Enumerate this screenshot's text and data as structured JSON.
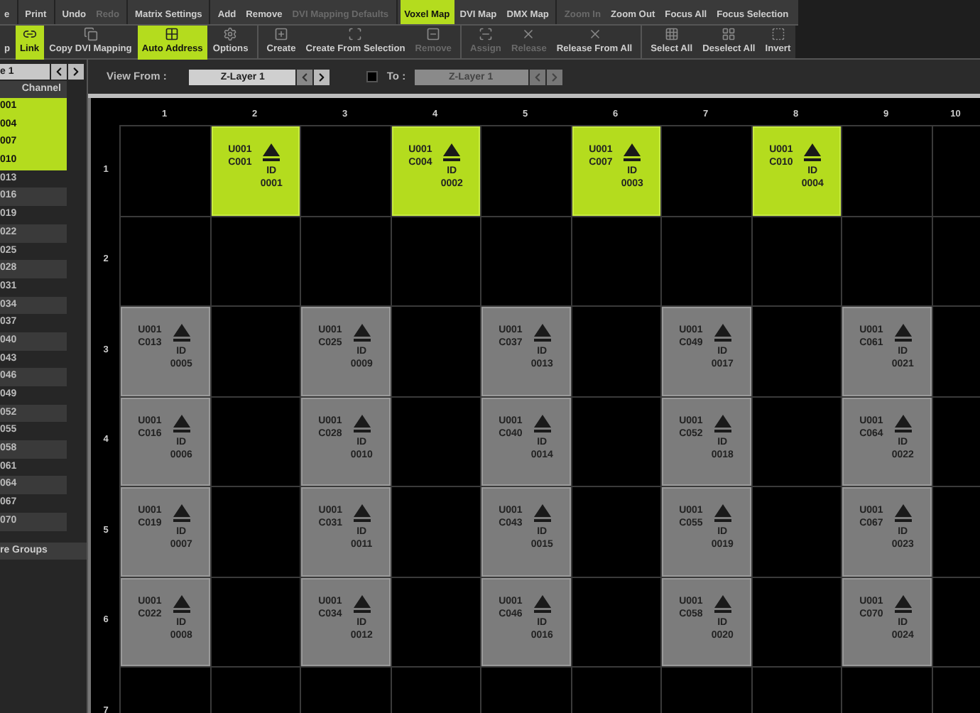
{
  "toolbar_top": [
    [
      {
        "label": "e",
        "selected": false,
        "disabled": false
      }
    ],
    [
      {
        "label": "Print",
        "selected": false,
        "disabled": false
      }
    ],
    [
      {
        "label": "Undo",
        "selected": false,
        "disabled": false
      },
      {
        "label": "Redo",
        "selected": false,
        "disabled": true
      }
    ],
    [
      {
        "label": "Matrix Settings",
        "selected": false,
        "disabled": false
      }
    ],
    [
      {
        "label": "Add",
        "selected": false,
        "disabled": false
      },
      {
        "label": "Remove",
        "selected": false,
        "disabled": false
      },
      {
        "label": "DVI Mapping Defaults",
        "selected": false,
        "disabled": true
      }
    ],
    [
      {
        "label": "Voxel Map",
        "selected": true,
        "disabled": false
      },
      {
        "label": "DVI Map",
        "selected": false,
        "disabled": false
      },
      {
        "label": "DMX Map",
        "selected": false,
        "disabled": false
      }
    ],
    [
      {
        "label": "Zoom In",
        "selected": false,
        "disabled": true
      },
      {
        "label": "Zoom Out",
        "selected": false,
        "disabled": false
      },
      {
        "label": "Focus All",
        "selected": false,
        "disabled": false
      },
      {
        "label": "Focus Selection",
        "selected": false,
        "disabled": false
      }
    ]
  ],
  "toolbar_bottom": [
    [
      {
        "label": "p",
        "selected": false,
        "disabled": false
      },
      {
        "label": "Link",
        "selected": true,
        "disabled": false
      },
      {
        "label": "Copy DVI Mapping",
        "selected": false,
        "disabled": false
      },
      {
        "label": "Auto Address",
        "selected": true,
        "disabled": false
      },
      {
        "label": "Options",
        "selected": false,
        "disabled": false
      }
    ],
    [
      {
        "label": "Create",
        "selected": false,
        "disabled": false
      },
      {
        "label": "Create From Selection",
        "selected": false,
        "disabled": false
      },
      {
        "label": "Remove",
        "selected": false,
        "disabled": true
      }
    ],
    [
      {
        "label": "Assign",
        "selected": false,
        "disabled": true
      },
      {
        "label": "Release",
        "selected": false,
        "disabled": true
      },
      {
        "label": "Release From All",
        "selected": false,
        "disabled": false
      }
    ],
    [
      {
        "label": "Select All",
        "selected": false,
        "disabled": false
      },
      {
        "label": "Deselect All",
        "selected": false,
        "disabled": false
      },
      {
        "label": "Invert",
        "selected": false,
        "disabled": false
      }
    ]
  ],
  "sidebar": {
    "layer": "e 1",
    "column_header": "Channel",
    "items": [
      {
        "label": "001",
        "selected": true
      },
      {
        "label": "004",
        "selected": true
      },
      {
        "label": "007",
        "selected": true
      },
      {
        "label": "010",
        "selected": true
      },
      {
        "label": "013",
        "selected": false
      },
      {
        "label": "016",
        "selected": false
      },
      {
        "label": "019",
        "selected": false
      },
      {
        "label": "022",
        "selected": false
      },
      {
        "label": "025",
        "selected": false
      },
      {
        "label": "028",
        "selected": false
      },
      {
        "label": "031",
        "selected": false
      },
      {
        "label": "034",
        "selected": false
      },
      {
        "label": "037",
        "selected": false
      },
      {
        "label": "040",
        "selected": false
      },
      {
        "label": "043",
        "selected": false
      },
      {
        "label": "046",
        "selected": false
      },
      {
        "label": "049",
        "selected": false
      },
      {
        "label": "052",
        "selected": false
      },
      {
        "label": "055",
        "selected": false
      },
      {
        "label": "058",
        "selected": false
      },
      {
        "label": "061",
        "selected": false
      },
      {
        "label": "064",
        "selected": false
      },
      {
        "label": "067",
        "selected": false
      },
      {
        "label": "070",
        "selected": false
      }
    ],
    "groups_header": "re Groups"
  },
  "view_bar": {
    "from_label": "View From :",
    "from_value": "Z-Layer 1",
    "to_checked": false,
    "to_label": "To :",
    "to_value": "Z-Layer 1"
  },
  "grid": {
    "columns": [
      "1",
      "2",
      "3",
      "4",
      "5",
      "6",
      "7",
      "8",
      "9",
      "10"
    ],
    "rows": [
      {
        "label": "1",
        "cells": [
          {
            "kind": "empty"
          },
          {
            "kind": "fixture",
            "selected": true,
            "universe": "U001",
            "channel": "C001",
            "id_label": "ID",
            "id": "0001"
          },
          {
            "kind": "empty"
          },
          {
            "kind": "fixture",
            "selected": true,
            "universe": "U001",
            "channel": "C004",
            "id_label": "ID",
            "id": "0002"
          },
          {
            "kind": "empty"
          },
          {
            "kind": "fixture",
            "selected": true,
            "universe": "U001",
            "channel": "C007",
            "id_label": "ID",
            "id": "0003"
          },
          {
            "kind": "empty"
          },
          {
            "kind": "fixture",
            "selected": true,
            "universe": "U001",
            "channel": "C010",
            "id_label": "ID",
            "id": "0004"
          },
          {
            "kind": "empty"
          },
          {
            "kind": "empty"
          }
        ]
      },
      {
        "label": "2",
        "cells": [
          {
            "kind": "empty"
          },
          {
            "kind": "empty"
          },
          {
            "kind": "empty"
          },
          {
            "kind": "empty"
          },
          {
            "kind": "empty"
          },
          {
            "kind": "empty"
          },
          {
            "kind": "empty"
          },
          {
            "kind": "empty"
          },
          {
            "kind": "empty"
          },
          {
            "kind": "empty"
          }
        ]
      },
      {
        "label": "3",
        "cells": [
          {
            "kind": "fixture",
            "selected": false,
            "universe": "U001",
            "channel": "C013",
            "id_label": "ID",
            "id": "0005"
          },
          {
            "kind": "empty"
          },
          {
            "kind": "fixture",
            "selected": false,
            "universe": "U001",
            "channel": "C025",
            "id_label": "ID",
            "id": "0009"
          },
          {
            "kind": "empty"
          },
          {
            "kind": "fixture",
            "selected": false,
            "universe": "U001",
            "channel": "C037",
            "id_label": "ID",
            "id": "0013"
          },
          {
            "kind": "empty"
          },
          {
            "kind": "fixture",
            "selected": false,
            "universe": "U001",
            "channel": "C049",
            "id_label": "ID",
            "id": "0017"
          },
          {
            "kind": "empty"
          },
          {
            "kind": "fixture",
            "selected": false,
            "universe": "U001",
            "channel": "C061",
            "id_label": "ID",
            "id": "0021"
          },
          {
            "kind": "empty"
          }
        ]
      },
      {
        "label": "4",
        "cells": [
          {
            "kind": "fixture",
            "selected": false,
            "universe": "U001",
            "channel": "C016",
            "id_label": "ID",
            "id": "0006"
          },
          {
            "kind": "empty"
          },
          {
            "kind": "fixture",
            "selected": false,
            "universe": "U001",
            "channel": "C028",
            "id_label": "ID",
            "id": "0010"
          },
          {
            "kind": "empty"
          },
          {
            "kind": "fixture",
            "selected": false,
            "universe": "U001",
            "channel": "C040",
            "id_label": "ID",
            "id": "0014"
          },
          {
            "kind": "empty"
          },
          {
            "kind": "fixture",
            "selected": false,
            "universe": "U001",
            "channel": "C052",
            "id_label": "ID",
            "id": "0018"
          },
          {
            "kind": "empty"
          },
          {
            "kind": "fixture",
            "selected": false,
            "universe": "U001",
            "channel": "C064",
            "id_label": "ID",
            "id": "0022"
          },
          {
            "kind": "empty"
          }
        ]
      },
      {
        "label": "5",
        "cells": [
          {
            "kind": "fixture",
            "selected": false,
            "universe": "U001",
            "channel": "C019",
            "id_label": "ID",
            "id": "0007"
          },
          {
            "kind": "empty"
          },
          {
            "kind": "fixture",
            "selected": false,
            "universe": "U001",
            "channel": "C031",
            "id_label": "ID",
            "id": "0011"
          },
          {
            "kind": "empty"
          },
          {
            "kind": "fixture",
            "selected": false,
            "universe": "U001",
            "channel": "C043",
            "id_label": "ID",
            "id": "0015"
          },
          {
            "kind": "empty"
          },
          {
            "kind": "fixture",
            "selected": false,
            "universe": "U001",
            "channel": "C055",
            "id_label": "ID",
            "id": "0019"
          },
          {
            "kind": "empty"
          },
          {
            "kind": "fixture",
            "selected": false,
            "universe": "U001",
            "channel": "C067",
            "id_label": "ID",
            "id": "0023"
          },
          {
            "kind": "empty"
          }
        ]
      },
      {
        "label": "6",
        "cells": [
          {
            "kind": "fixture",
            "selected": false,
            "universe": "U001",
            "channel": "C022",
            "id_label": "ID",
            "id": "0008"
          },
          {
            "kind": "empty"
          },
          {
            "kind": "fixture",
            "selected": false,
            "universe": "U001",
            "channel": "C034",
            "id_label": "ID",
            "id": "0012"
          },
          {
            "kind": "empty"
          },
          {
            "kind": "fixture",
            "selected": false,
            "universe": "U001",
            "channel": "C046",
            "id_label": "ID",
            "id": "0016"
          },
          {
            "kind": "empty"
          },
          {
            "kind": "fixture",
            "selected": false,
            "universe": "U001",
            "channel": "C058",
            "id_label": "ID",
            "id": "0020"
          },
          {
            "kind": "empty"
          },
          {
            "kind": "fixture",
            "selected": false,
            "universe": "U001",
            "channel": "C070",
            "id_label": "ID",
            "id": "0024"
          },
          {
            "kind": "empty"
          }
        ]
      },
      {
        "label": "7",
        "cells": [
          {
            "kind": "empty"
          },
          {
            "kind": "empty"
          },
          {
            "kind": "empty"
          },
          {
            "kind": "empty"
          },
          {
            "kind": "empty"
          },
          {
            "kind": "empty"
          },
          {
            "kind": "empty"
          },
          {
            "kind": "empty"
          },
          {
            "kind": "empty"
          },
          {
            "kind": "empty"
          }
        ]
      }
    ]
  }
}
